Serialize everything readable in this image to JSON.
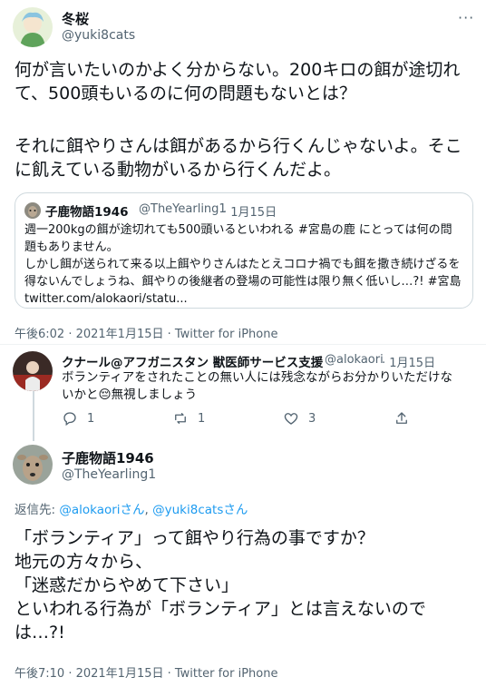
{
  "main_tweet": {
    "author_name": "冬桜",
    "author_handle": "@yuki8cats",
    "text_p1": "何が言いたいのかよく分からない。200キロの餌が途切れて、500頭もいるのに何の問題もないとは？",
    "text_p2": "それに餌やりさんは餌があるから行くんじゃないよ。そこに飢えている動物がいるから行くんだよ。",
    "timestamp": "午後6:02 · 2021年1月15日 · Twitter for iPhone"
  },
  "quoted_tweet": {
    "author_name": "子鹿物語1946",
    "author_handle": "@TheYearling1",
    "date": "· 1月15日",
    "text": "週一200kgの餌が途切れても500頭いるといわれる #宮島の鹿 にとっては何の問題もありません。\nしかし餌が送られて来る以上餌やりさんはたとえコロナ禍でも餌を撒き続けざるを得ないんでしょうね、餌やりの後継者の登場の可能性は限り無く低いし…?! #宮島 twitter.com/alokaori/statu..."
  },
  "reply_tweet": {
    "author_name": "クナール@アフガニスタン 獣医師サービス支援",
    "author_handle": "@alokaori",
    "date": "· 1月15日",
    "text": "ボランティアをされたことの無い人には残念ながらお分かりいただけないかと😔無視しましょう",
    "reply_count": "1",
    "retweet_count": "1",
    "like_count": "3"
  },
  "focus_tweet": {
    "author_name": "子鹿物語1946",
    "author_handle": "@TheYearling1",
    "replying_to_label": "返信先: ",
    "replying_to_1": "@alokaoriさん",
    "replying_to_sep": ", ",
    "replying_to_2": "@yuki8catsさん",
    "text": "「ボランティア」って餌やり行為の事ですか？\n地元の方々から、\n「迷惑だからやめて下さい」\nといわれる行為が「ボランティア」とは言えないのでは…?!",
    "timestamp": "午後7:10 · 2021年1月15日 · Twitter for iPhone"
  },
  "icons": {
    "more": "more-options-icon",
    "reply": "reply-icon",
    "retweet": "retweet-icon",
    "like": "like-icon",
    "share": "share-icon"
  },
  "colors": {
    "text": "#0f1419",
    "secondary": "#536471",
    "link": "#1d9bf0",
    "border": "#cfd9de"
  }
}
